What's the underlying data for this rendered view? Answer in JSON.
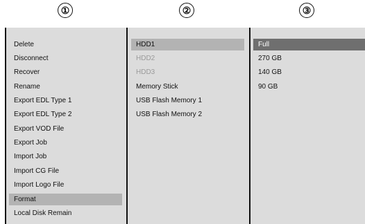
{
  "callouts": [
    "①",
    "②",
    "③"
  ],
  "menu_column": {
    "items": [
      {
        "label": "Delete"
      },
      {
        "label": "Disconnect"
      },
      {
        "label": "Recover"
      },
      {
        "label": "Rename"
      },
      {
        "label": "Export EDL Type 1"
      },
      {
        "label": "Export EDL Type 2"
      },
      {
        "label": "Export VOD File"
      },
      {
        "label": "Export Job"
      },
      {
        "label": "Import Job"
      },
      {
        "label": "Import CG File"
      },
      {
        "label": "Import Logo File"
      },
      {
        "label": "Format",
        "selected": true
      },
      {
        "label": "Local Disk Remain"
      }
    ]
  },
  "device_column": {
    "items": [
      {
        "label": "HDD1",
        "selected": true
      },
      {
        "label": "HDD2",
        "disabled": true
      },
      {
        "label": "HDD3",
        "disabled": true
      },
      {
        "label": "Memory Stick"
      },
      {
        "label": "USB Flash Memory 1"
      },
      {
        "label": "USB Flash Memory 2"
      }
    ]
  },
  "size_column": {
    "items": [
      {
        "label": "Full",
        "selected": true
      },
      {
        "label": "270 GB"
      },
      {
        "label": "140 GB"
      },
      {
        "label": "90 GB"
      }
    ]
  }
}
